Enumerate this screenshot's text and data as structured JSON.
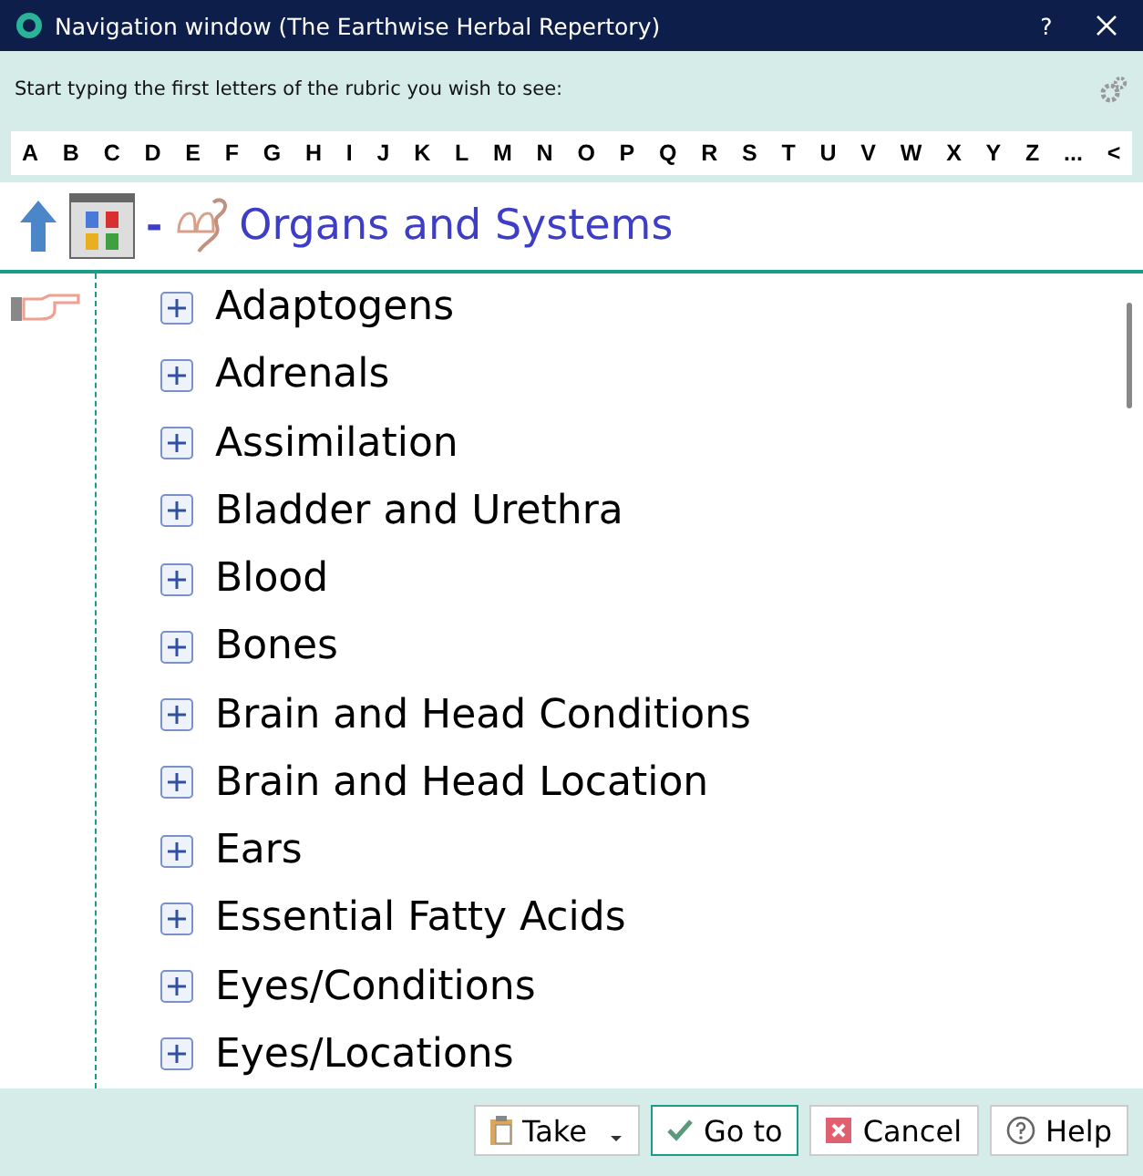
{
  "window": {
    "title": "Navigation window (The Earthwise Herbal Repertory)",
    "help": "?"
  },
  "prompt": "Start typing the first letters of the rubric you wish to see:",
  "letters": [
    "A",
    "B",
    "C",
    "D",
    "E",
    "F",
    "G",
    "H",
    "I",
    "J",
    "K",
    "L",
    "M",
    "N",
    "O",
    "P",
    "Q",
    "R",
    "S",
    "T",
    "U",
    "V",
    "W",
    "X",
    "Y",
    "Z",
    "...",
    "<"
  ],
  "header": {
    "separator": "-",
    "title": "Organs and Systems"
  },
  "items": [
    {
      "label": "Adaptogens",
      "expanded": false
    },
    {
      "label": "Adrenals",
      "expanded": false
    },
    {
      "label": "Assimilation",
      "expanded": false
    },
    {
      "label": "Bladder and Urethra",
      "expanded": false
    },
    {
      "label": "Blood",
      "expanded": false
    },
    {
      "label": "Bones",
      "expanded": false
    },
    {
      "label": "Brain and Head Conditions",
      "expanded": false
    },
    {
      "label": "Brain and Head Location",
      "expanded": false
    },
    {
      "label": "Ears",
      "expanded": false
    },
    {
      "label": "Essential Fatty Acids",
      "expanded": false
    },
    {
      "label": "Eyes/Conditions",
      "expanded": false
    },
    {
      "label": "Eyes/Locations",
      "expanded": false
    }
  ],
  "buttons": [
    {
      "kind": "take",
      "label": "Take"
    },
    {
      "kind": "goto",
      "label": "Go to"
    },
    {
      "kind": "cancel",
      "label": "Cancel"
    },
    {
      "kind": "help",
      "label": "Help"
    }
  ]
}
